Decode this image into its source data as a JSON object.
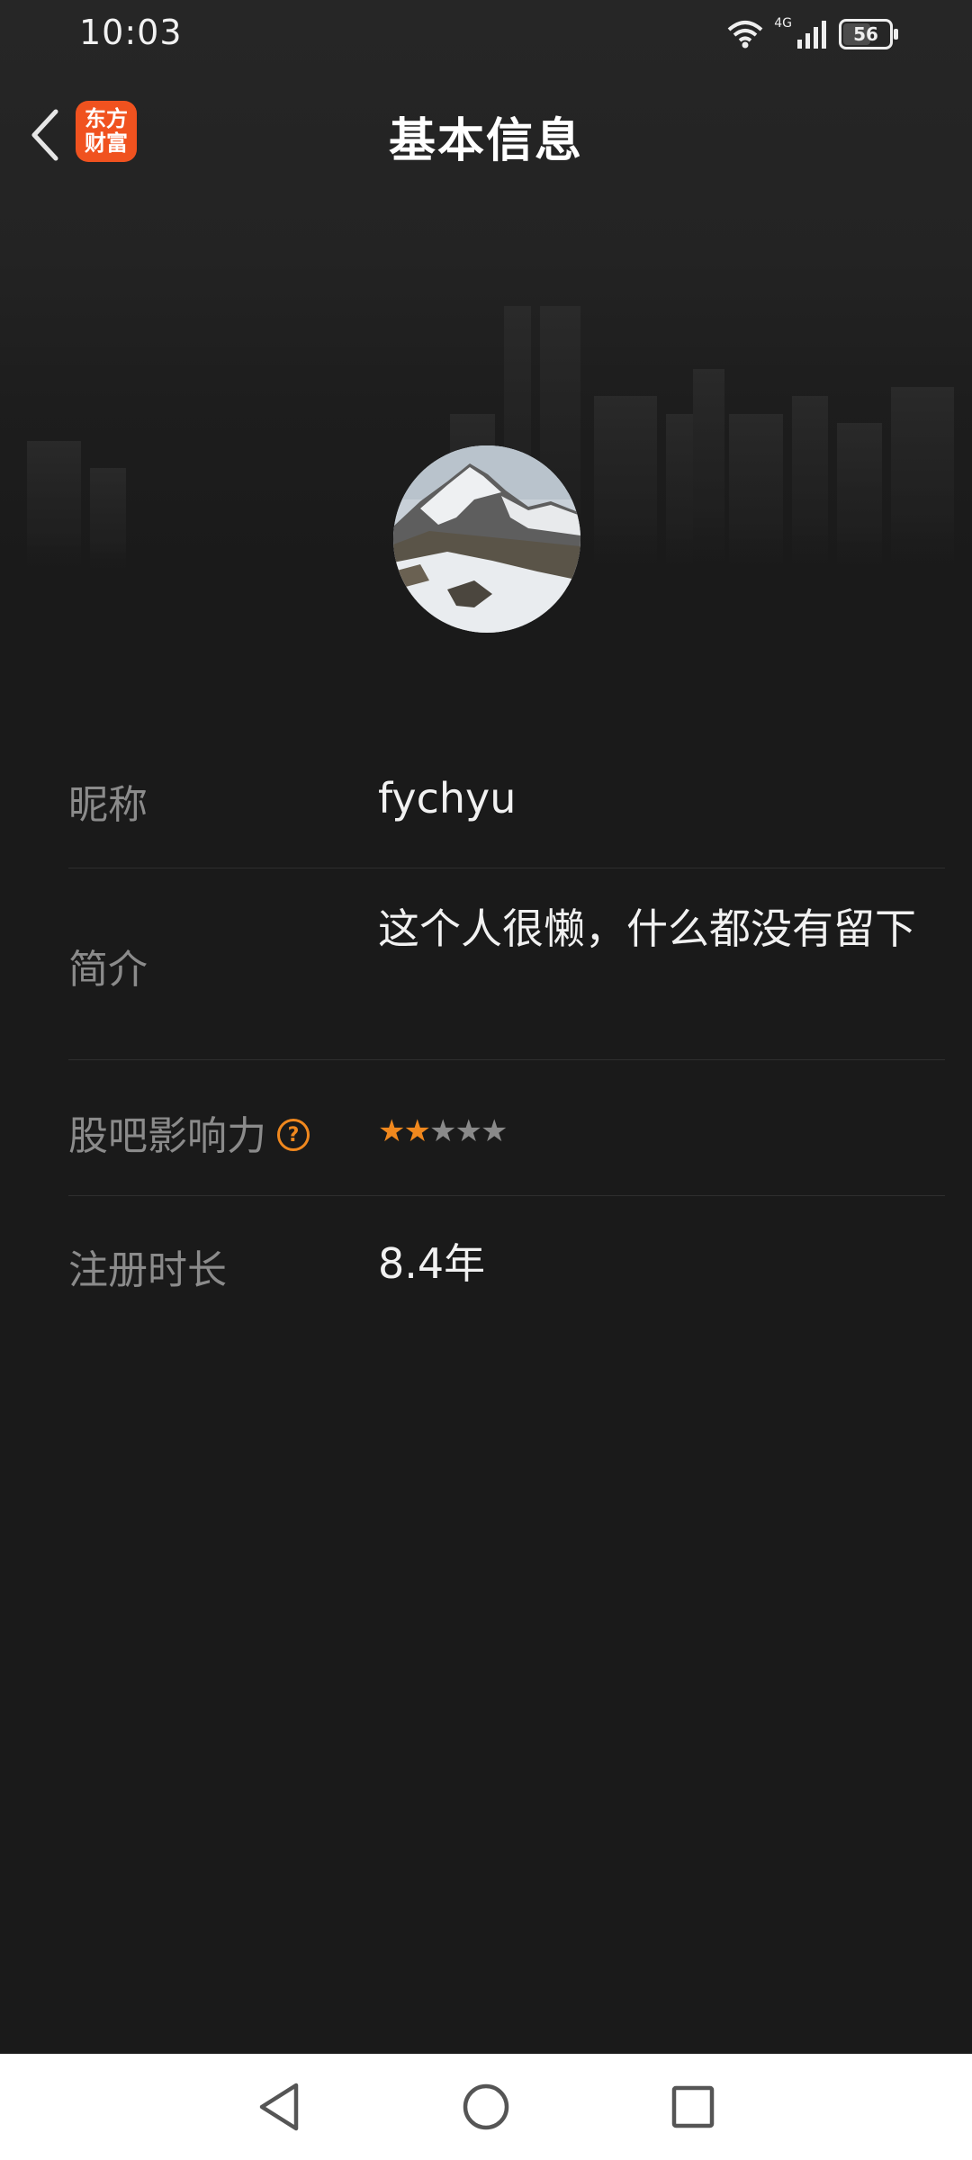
{
  "status_bar": {
    "time": "10:03",
    "network": "4G",
    "battery": "56",
    "battery_level": 0.56,
    "icons": [
      "wifi-icon",
      "cellular-signal-icon",
      "battery-icon"
    ]
  },
  "header": {
    "title": "基本信息",
    "back_icon": "chevron-left-icon",
    "logo_line1": "东方",
    "logo_line2": "财富"
  },
  "profile": {
    "avatar": "avatar-image",
    "rows": [
      {
        "label": "昵称",
        "value": "fychyu"
      },
      {
        "label": "简介",
        "value": "这个人很懒，什么都没有留下"
      },
      {
        "label": "股吧影响力",
        "help_icon": "?",
        "rating": 2,
        "rating_max": 5
      },
      {
        "label": "注册时长",
        "value": "8.4年"
      }
    ]
  },
  "colors": {
    "background": "#1a1a1a",
    "accent": "#f0881e",
    "logo": "#f0521f",
    "label": "#8b8b8b",
    "value": "#f1f1f1"
  },
  "nav_bar": {
    "icons": [
      "back-triangle-icon",
      "home-circle-icon",
      "recents-square-icon"
    ]
  }
}
